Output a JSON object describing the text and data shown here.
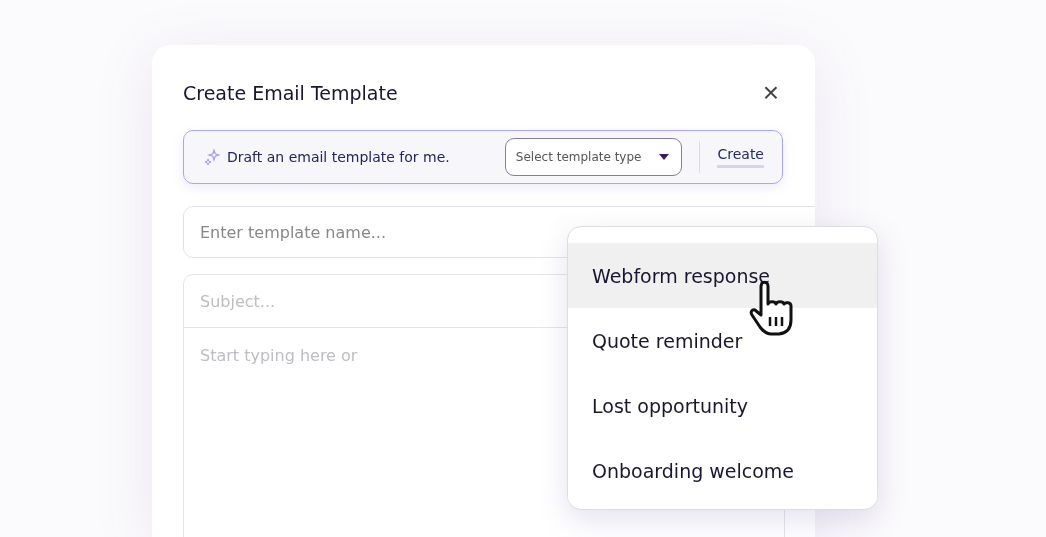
{
  "dialog": {
    "title": "Create Email Template",
    "close": "×"
  },
  "ai_bar": {
    "prompt": "Draft an email template for me.",
    "template_type": {
      "label": "Select template type",
      "expanded": true
    },
    "create": "Create"
  },
  "name_field": {
    "placeholder": "Enter template name..."
  },
  "subject_field": {
    "placeholder": "Subject..."
  },
  "body_field": {
    "placeholder": "Start typing here or"
  },
  "template_menu": [
    {
      "label": "Webform response",
      "selected": true
    },
    {
      "label": "Quote reminder",
      "selected": false
    },
    {
      "label": "Lost opportunity",
      "selected": false
    },
    {
      "label": "Onboarding welcome",
      "selected": false
    }
  ]
}
